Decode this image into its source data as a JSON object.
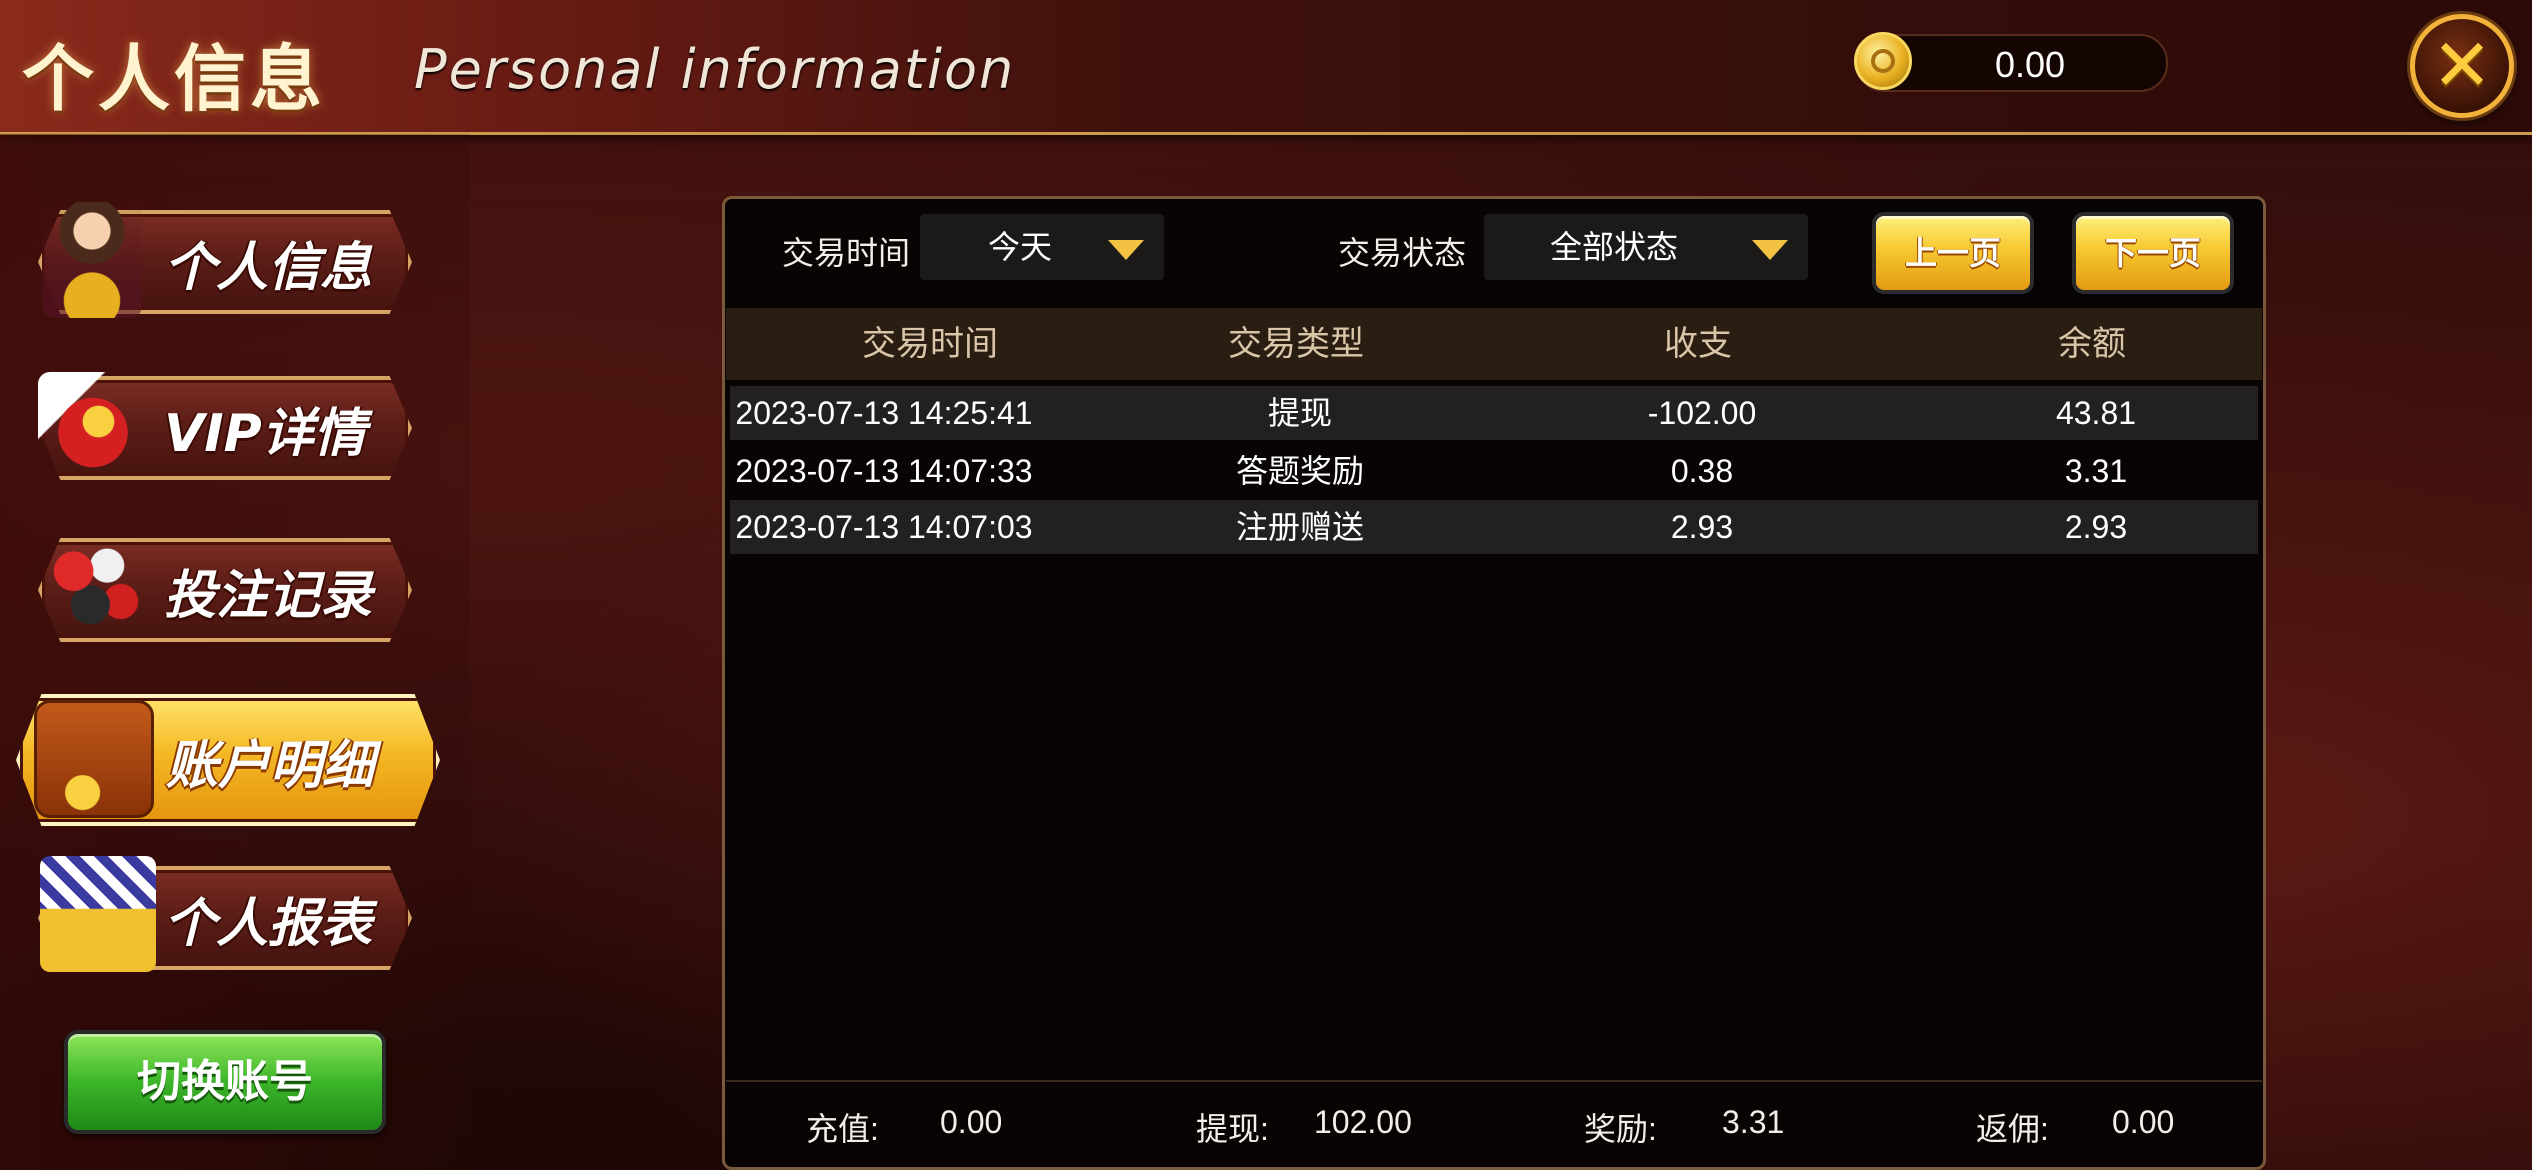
{
  "header": {
    "title_cn": "个人信息",
    "title_en": "Personal information",
    "balance": "0.00",
    "close_label": "✕"
  },
  "sidebar": {
    "items": [
      {
        "label": "个人信息",
        "icon": "avatar-girl-icon",
        "active": false
      },
      {
        "label": "VIP详情",
        "icon": "vip-crown-icon",
        "active": false
      },
      {
        "label": "投注记录",
        "icon": "casino-chips-icon",
        "active": false
      },
      {
        "label": "账户明细",
        "icon": "wallet-icon",
        "active": true
      },
      {
        "label": "个人报表",
        "icon": "report-chart-icon",
        "active": false
      }
    ],
    "switch_account": "切换账号"
  },
  "filters": {
    "time_label": "交易时间",
    "time_value": "今天",
    "status_label": "交易状态",
    "status_value": "全部状态",
    "prev_page": "上一页",
    "next_page": "下一页"
  },
  "table": {
    "columns": [
      "交易时间",
      "交易类型",
      "收支",
      "余额"
    ],
    "rows": [
      {
        "time": "2023-07-13 14:25:41",
        "type": "提现",
        "amount": "-102.00",
        "balance": "43.81"
      },
      {
        "time": "2023-07-13 14:07:33",
        "type": "答题奖励",
        "amount": "0.38",
        "balance": "3.31"
      },
      {
        "time": "2023-07-13 14:07:03",
        "type": "注册赠送",
        "amount": "2.93",
        "balance": "2.93"
      }
    ]
  },
  "summary": {
    "recharge_label": "充值:",
    "recharge_value": "0.00",
    "withdraw_label": "提现:",
    "withdraw_value": "102.00",
    "reward_label": "奖励:",
    "reward_value": "3.31",
    "rebate_label": "返佣:",
    "rebate_value": "0.00"
  },
  "colors": {
    "accent_gold": "#f3c243",
    "panel_bg": "#080404",
    "header_bg": "#6a1c14",
    "switch_green": "#3cb52a"
  }
}
